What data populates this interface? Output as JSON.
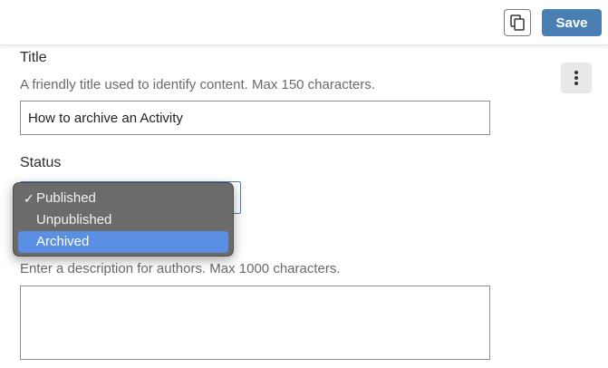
{
  "header": {
    "copy_icon": "copy-icon",
    "save_label": "Save"
  },
  "more_icon": "vertical-ellipsis-icon",
  "title_field": {
    "label": "Title",
    "help": "A friendly title used to identify content. Max 150 characters.",
    "value": "How to archive an Activity"
  },
  "status_field": {
    "label": "Status",
    "options": [
      {
        "label": "Published",
        "checked": true,
        "highlighted": false
      },
      {
        "label": "Unpublished",
        "checked": false,
        "highlighted": false
      },
      {
        "label": "Archived",
        "checked": false,
        "highlighted": true
      }
    ],
    "check_mark": "✓"
  },
  "description_field": {
    "help": "Enter a description for authors. Max 1000 characters.",
    "value": ""
  },
  "colors": {
    "save_button": "#4a7fb3",
    "menu_highlight": "#5b8fe4",
    "menu_background": "#6b6b6b"
  }
}
